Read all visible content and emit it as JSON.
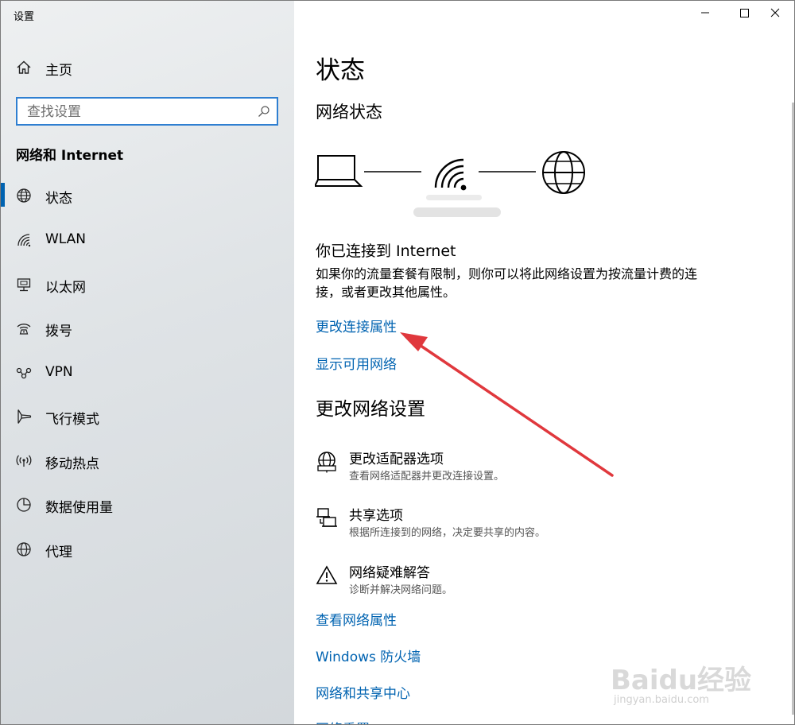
{
  "window": {
    "title": "设置",
    "controls": {
      "minimize": "—",
      "maximize": "☐",
      "close": "✕"
    }
  },
  "sidebar": {
    "home_label": "主页",
    "search": {
      "placeholder": "查找设置",
      "value": ""
    },
    "section_title": "网络和 Internet",
    "items": [
      {
        "label": "状态",
        "icon": "globe-icon",
        "active": true
      },
      {
        "label": "WLAN",
        "icon": "wifi-icon",
        "active": false
      },
      {
        "label": "以太网",
        "icon": "ethernet-icon",
        "active": false
      },
      {
        "label": "拨号",
        "icon": "dialup-icon",
        "active": false
      },
      {
        "label": "VPN",
        "icon": "vpn-icon",
        "active": false
      },
      {
        "label": "飞行模式",
        "icon": "airplane-icon",
        "active": false
      },
      {
        "label": "移动热点",
        "icon": "hotspot-icon",
        "active": false
      },
      {
        "label": "数据使用量",
        "icon": "data-usage-icon",
        "active": false
      },
      {
        "label": "代理",
        "icon": "globe-icon",
        "active": false
      }
    ]
  },
  "main": {
    "page_title": "状态",
    "network_status_heading": "网络状态",
    "connected_title": "你已连接到 Internet",
    "connected_desc": "如果你的流量套餐有限制，则你可以将此网络设置为按流量计费的连接，或者更改其他属性。",
    "links_top": [
      {
        "label": "更改连接属性"
      },
      {
        "label": "显示可用网络"
      }
    ],
    "change_settings_heading": "更改网络设置",
    "options": [
      {
        "title": "更改适配器选项",
        "desc": "查看网络适配器并更改连接设置。",
        "icon": "adapter-icon"
      },
      {
        "title": "共享选项",
        "desc": "根据所连接到的网络，决定要共享的内容。",
        "icon": "sharing-icon"
      },
      {
        "title": "网络疑难解答",
        "desc": "诊断并解决网络问题。",
        "icon": "warning-icon"
      }
    ],
    "links_bottom": [
      {
        "label": "查看网络属性"
      },
      {
        "label": "Windows 防火墙"
      },
      {
        "label": "网络和共享中心"
      },
      {
        "label": "网络重置"
      }
    ]
  },
  "watermark": {
    "brand": "Baidu经验",
    "url": "jingyan.baidu.com"
  },
  "colors": {
    "accent": "#0063b1",
    "link": "#0063b1",
    "arrow": "#e0383d",
    "search_border": "#2f7fd1"
  }
}
